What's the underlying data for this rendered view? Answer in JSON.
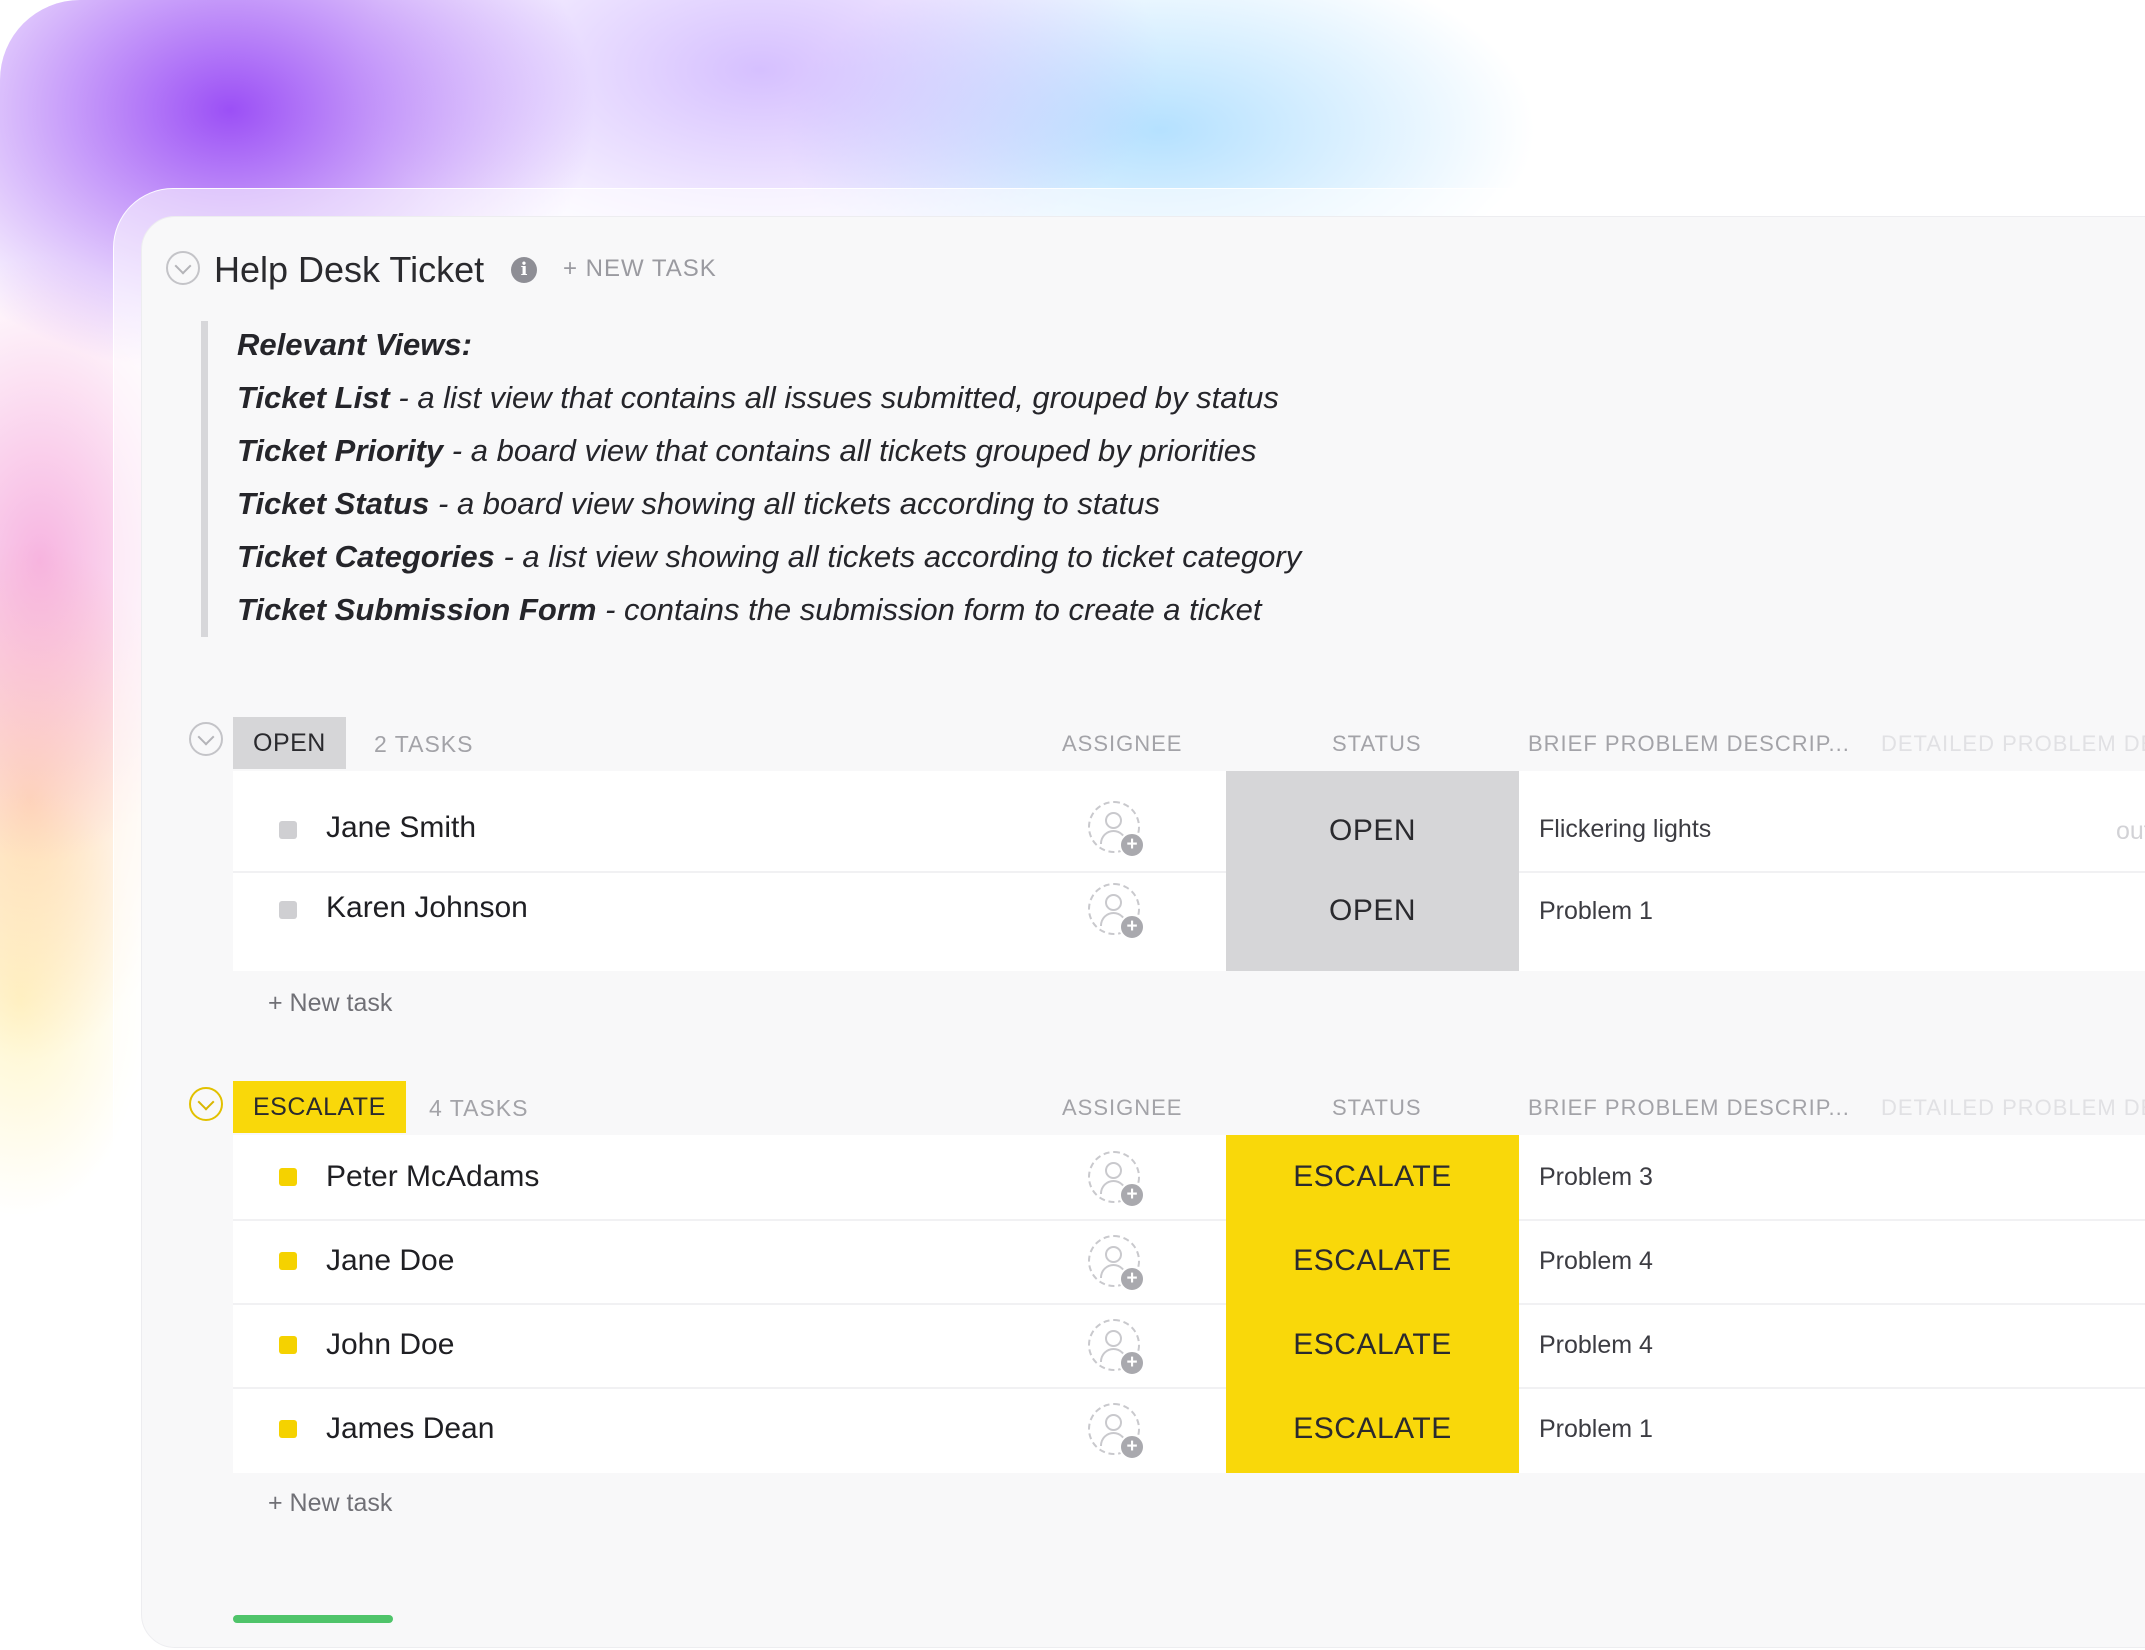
{
  "header": {
    "title": "Help Desk Ticket",
    "new_task_label": "+ NEW TASK"
  },
  "description": {
    "heading": "Relevant Views:",
    "lines": [
      {
        "name": "Ticket List",
        "text": " - a list view that contains all issues submitted, grouped by status"
      },
      {
        "name": "Ticket Priority",
        "text": " - a board view that contains all tickets grouped by priorities"
      },
      {
        "name": "Ticket Status",
        "text": " - a board view showing all tickets according to status"
      },
      {
        "name": "Ticket Categories",
        "text": " - a list view showing all tickets according to ticket category"
      },
      {
        "name": "Ticket Submission Form",
        "text": " - contains the submission form to create a ticket"
      }
    ]
  },
  "columns": {
    "assignee": "ASSIGNEE",
    "status": "STATUS",
    "brief": "BRIEF PROBLEM DESCRIP...",
    "detailed": "DETAILED PROBLEM DE"
  },
  "groups": [
    {
      "label": "OPEN",
      "count": "2 TASKS",
      "color": "#d6d6d8",
      "bullet_color": "#cfcfd2",
      "new_task": "+ New task",
      "tasks": [
        {
          "name": "Jane Smith",
          "status": "OPEN",
          "brief": "Flickering lights",
          "detail": "outside warran"
        },
        {
          "name": "Karen Johnson",
          "status": "OPEN",
          "brief": "Problem 1",
          "detail": "–"
        }
      ]
    },
    {
      "label": "ESCALATE",
      "count": "4 TASKS",
      "color": "#f9d80a",
      "bullet_color": "#f5d200",
      "new_task": "+ New task",
      "tasks": [
        {
          "name": "Peter McAdams",
          "status": "ESCALATE",
          "brief": "Problem 3",
          "detail": "–"
        },
        {
          "name": "Jane Doe",
          "status": "ESCALATE",
          "brief": "Problem 4",
          "detail": "–"
        },
        {
          "name": "John Doe",
          "status": "ESCALATE",
          "brief": "Problem 4",
          "detail": "–"
        },
        {
          "name": "James Dean",
          "status": "ESCALATE",
          "brief": "Problem 1",
          "detail": "–"
        }
      ]
    }
  ]
}
